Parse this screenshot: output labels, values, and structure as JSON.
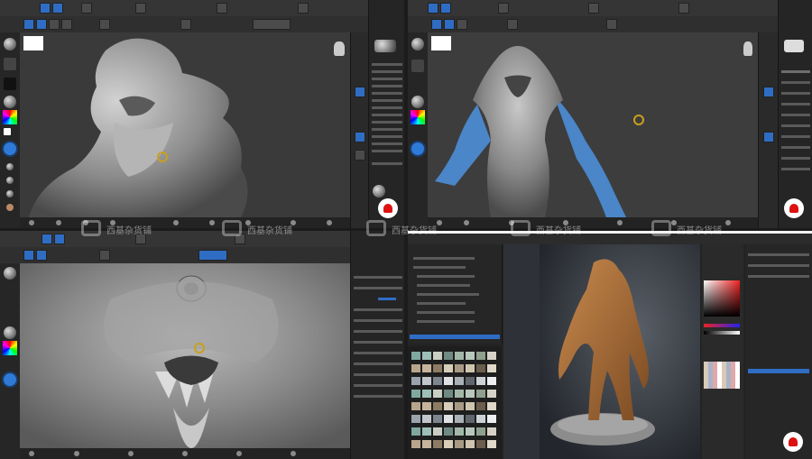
{
  "watermark": {
    "text": "西基杂货铺"
  },
  "panels": {
    "top_left": {
      "subject": "creature bust, gray clay"
    },
    "top_right": {
      "subject": "creature torso with blue masked arms"
    },
    "bottom_left": {
      "subject": "creature face close-up"
    },
    "bottom_right": {
      "subject": "textured creature on rock base"
    }
  },
  "colors": {
    "accent_blue": "#2f6dc4",
    "clay_gray": "#9a9a9a",
    "mask_blue": "#4a86c8",
    "creature_orange": "#b7793f",
    "logo_red": "#d11a1a"
  },
  "icons": [
    "brush-ball-icon",
    "color-picker-icon",
    "logo-icon",
    "brush-cursor-icon"
  ]
}
